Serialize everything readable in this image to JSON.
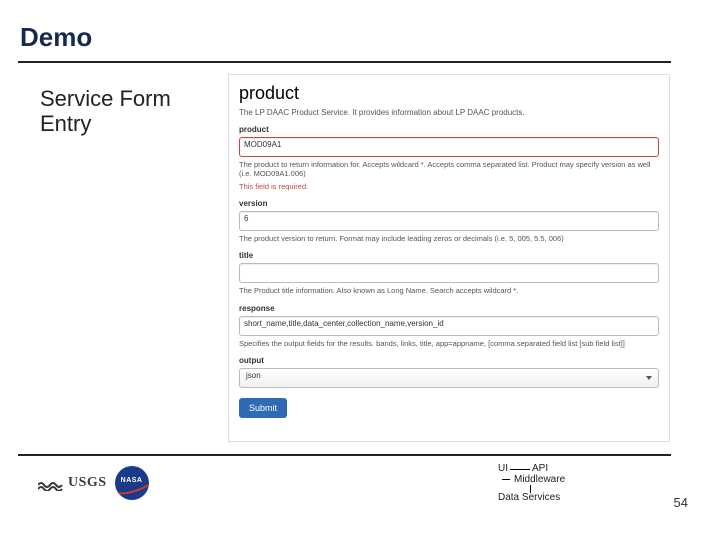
{
  "header": {
    "title": "Demo"
  },
  "caption": "Service Form Entry",
  "form": {
    "heading": "product",
    "subdesc": "The LP DAAC Product Service. It provides information about LP DAAC products.",
    "product": {
      "label": "product",
      "value": "MOD09A1",
      "help": "The product to return information for. Accepts wildcard *. Accepts comma separated list. Product may specify version as well (i.e. MOD09A1.006)",
      "required_msg": "This field is required."
    },
    "version": {
      "label": "version",
      "value": "6",
      "help": "The product version to return. Format may include leading zeros or decimals (i.e. 5, 005, 5.5, 006)"
    },
    "title": {
      "label": "title",
      "value": "",
      "help": "The Product title information. Also known as Long Name. Search accepts wildcard *."
    },
    "response": {
      "label": "response",
      "value": "short_name,title,data_center,collection_name,version_id",
      "help": "Specifies the output fields for the results. bands, links, title, app=appname, [comma separated field list [sub field list]]"
    },
    "output": {
      "label": "output",
      "value": "json"
    },
    "submit_label": "Submit"
  },
  "footer": {
    "logos": {
      "usgs": "USGS",
      "nasa": "NASA"
    },
    "diagram": {
      "ui": "UI",
      "api": "API",
      "middleware": "Middleware",
      "data_services": "Data Services"
    },
    "slide_number": "54"
  }
}
